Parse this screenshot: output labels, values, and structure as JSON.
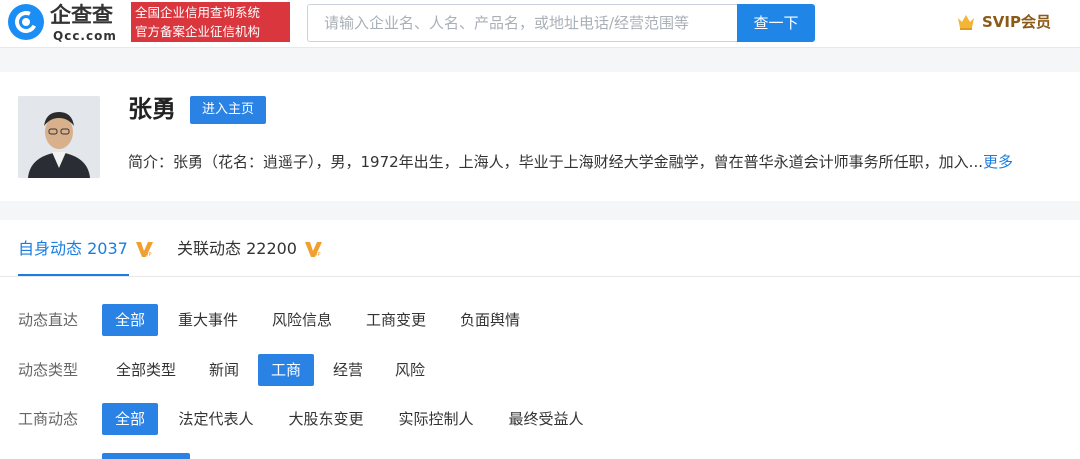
{
  "header": {
    "logo_cn": "企查查",
    "logo_en": "Qcc.com",
    "tagline_line1": "全国企业信用查询系统",
    "tagline_line2": "官方备案企业征信机构",
    "search_placeholder": "请输入企业名、人名、产品名，或地址电话/经营范围等",
    "search_button": "查一下",
    "svip_label": "SVIP会员"
  },
  "profile": {
    "name": "张勇",
    "home_button": "进入主页",
    "intro_text": "简介：张勇（花名：逍遥子），男，1972年出生，上海人，毕业于上海财经大学金融学，曾在普华永道会计师事务所任职，加入...",
    "more_link": "更多"
  },
  "tabs": [
    {
      "label": "自身动态 2037",
      "active": true
    },
    {
      "label": "关联动态 22200",
      "active": false
    }
  ],
  "filters": {
    "row1": {
      "label": "动态直达",
      "options": [
        "全部",
        "重大事件",
        "风险信息",
        "工商变更",
        "负面舆情"
      ],
      "selected": "全部"
    },
    "row2": {
      "label": "动态类型",
      "options": [
        "全部类型",
        "新闻",
        "工商",
        "经营",
        "风险"
      ],
      "selected": "工商"
    },
    "row3": {
      "label": "工商动态",
      "options": [
        "全部",
        "法定代表人",
        "大股东变更",
        "实际控制人",
        "最终受益人"
      ],
      "selected": "全部"
    }
  },
  "colors": {
    "primary": "#2a82e4",
    "link": "#1a7ee0",
    "tagline_bg": "#d9363e",
    "vip_gold": "#8a5a16"
  }
}
